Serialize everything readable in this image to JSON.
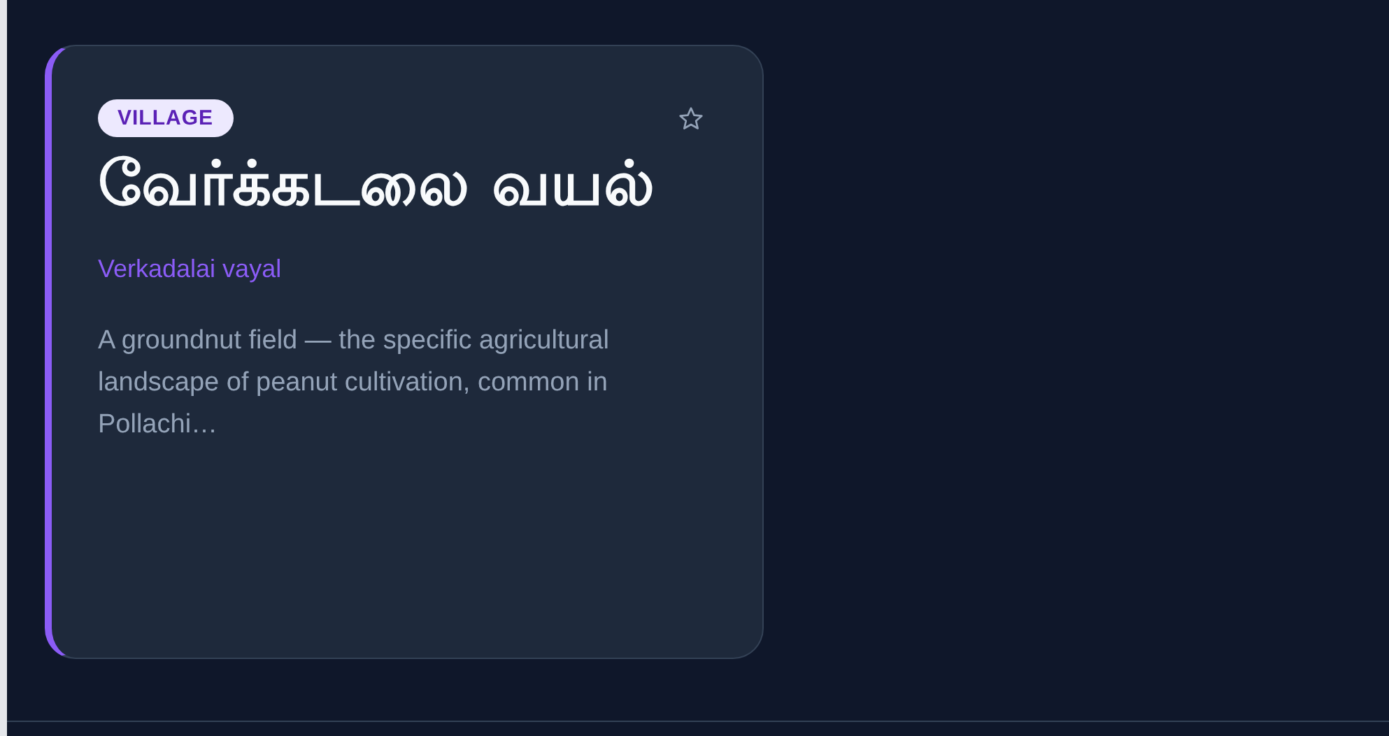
{
  "cards": [
    {
      "tag": "VILLAGE",
      "favorite": false,
      "title": "வேர்க்கடலை வயல்",
      "transliteration": "Verkadalai vayal",
      "description": "A groundnut field — the specific agricultural landscape of peanut cultivation, common in Pollachi…"
    }
  ]
}
